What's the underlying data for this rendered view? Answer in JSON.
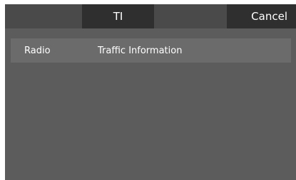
{
  "header": {
    "title": "TI",
    "cancel_label": "Cancel"
  },
  "list": {
    "items": [
      {
        "source": "Radio",
        "label": "Traffic Information"
      }
    ]
  }
}
